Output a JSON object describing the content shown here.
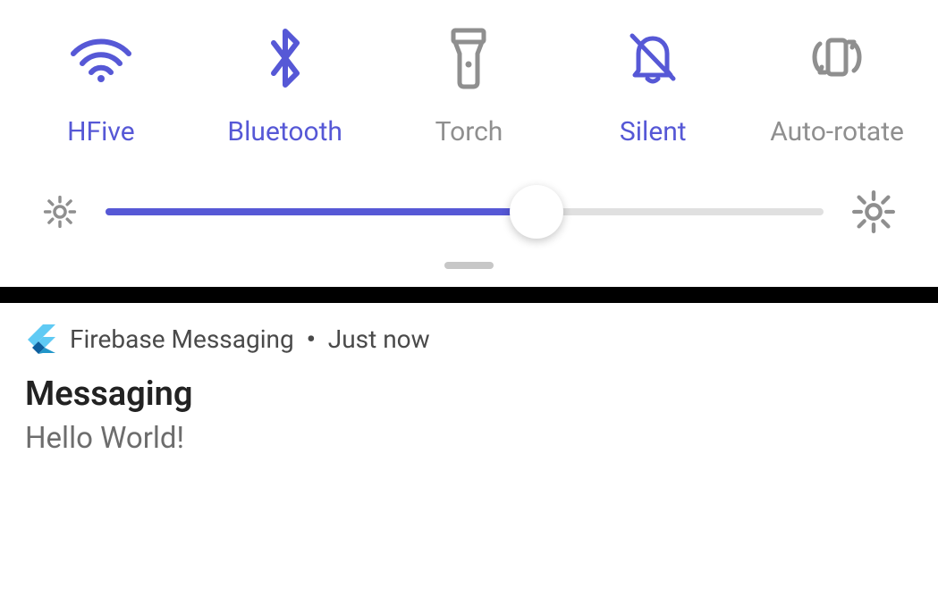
{
  "quick_settings": {
    "toggles": [
      {
        "label": "HFive",
        "active": true
      },
      {
        "label": "Bluetooth",
        "active": true
      },
      {
        "label": "Torch",
        "active": false
      },
      {
        "label": "Silent",
        "active": true
      },
      {
        "label": "Auto-rotate",
        "active": false
      }
    ],
    "brightness_percent": 60
  },
  "notification": {
    "app_name": "Firebase Messaging",
    "timestamp": "Just now",
    "title": "Messaging",
    "body": "Hello World!"
  }
}
